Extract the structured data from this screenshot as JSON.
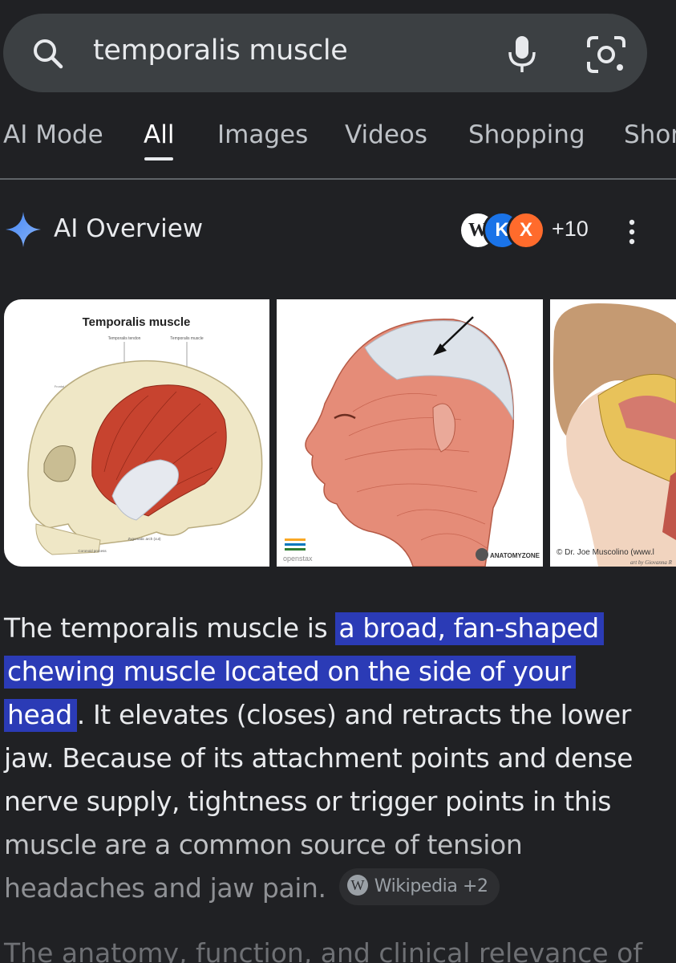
{
  "search": {
    "query": "temporalis muscle",
    "icons": [
      "search-icon",
      "microphone-icon",
      "google-lens-icon"
    ]
  },
  "tabs": [
    {
      "label": "AI Mode",
      "active": false
    },
    {
      "label": "All",
      "active": true
    },
    {
      "label": "Images",
      "active": false
    },
    {
      "label": "Videos",
      "active": false
    },
    {
      "label": "Shopping",
      "active": false
    },
    {
      "label": "Shor",
      "active": false
    }
  ],
  "ai_overview": {
    "title": "AI Overview",
    "sources": {
      "icons": [
        "W",
        "K",
        "X"
      ],
      "more_count": "+10"
    }
  },
  "images": [
    {
      "title": "Temporalis muscle",
      "labels": [
        "Temporalis tendon",
        "Temporalis muscle",
        "Parietal bone",
        "Frontal bone",
        "Zygomatic arch (cut)",
        "Coronoid process"
      ]
    },
    {
      "watermarks": [
        "openstax",
        "ANATOMYZONE"
      ]
    },
    {
      "credit": "© Dr. Joe Muscolino (www.l",
      "credit2": "art by Giovanna R"
    }
  ],
  "overview_text": {
    "intro": "The temporalis muscle is ",
    "highlight_1": "a broad, fan-shaped",
    "highlight_2": "chewing muscle located on the side of your",
    "highlight_3": "head",
    "line3_rest": ". It elevates (closes) and retracts the lower",
    "line4": "jaw. Because of its attachment points and dense",
    "line5": "nerve supply, tightness or trigger points in this",
    "line6": "muscle are a common source of tension",
    "line7": "headaches and jaw pain.",
    "citation": "Wikipedia +2",
    "citation_icon": "W"
  },
  "cutoff_text": "The anatomy, function, and clinical relevance of",
  "colors": {
    "background": "#202124",
    "search_bar": "#3c4043",
    "highlight": "#2b3bb6",
    "sparkle": "#4285f4"
  }
}
